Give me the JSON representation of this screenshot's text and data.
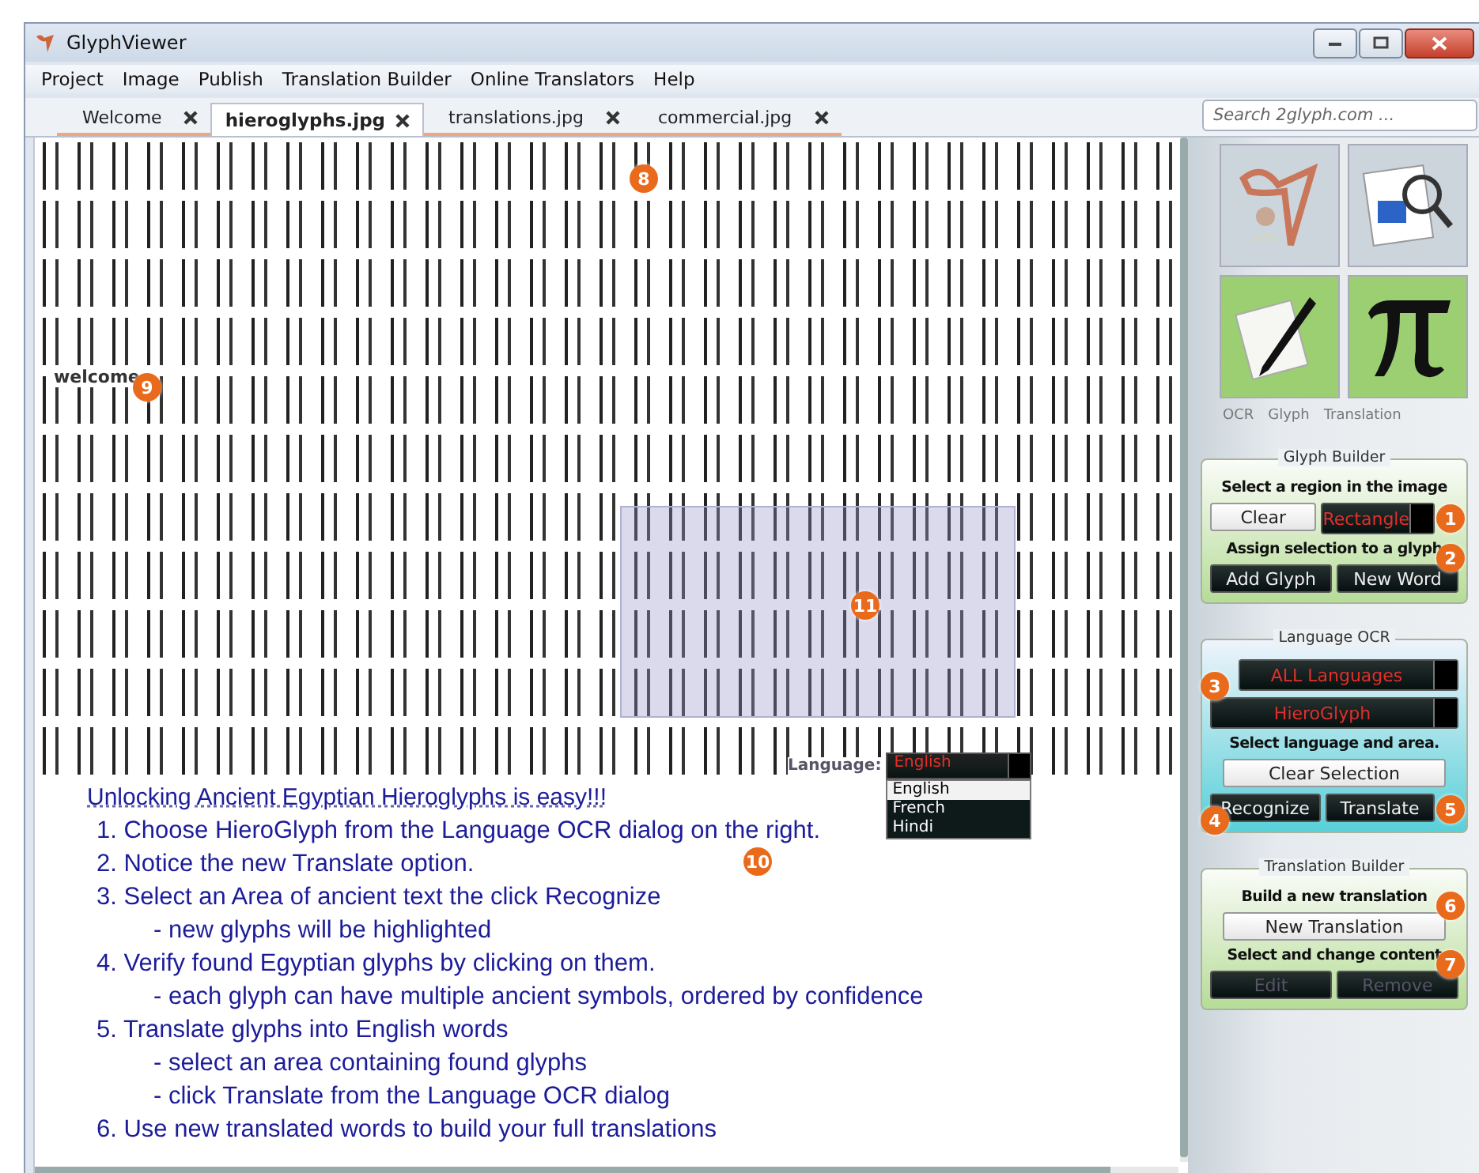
{
  "window": {
    "title": "GlyphViewer"
  },
  "menu": [
    "Project",
    "Image",
    "Publish",
    "Translation Builder",
    "Online Translators",
    "Help"
  ],
  "tabs": [
    {
      "label": "Welcome",
      "selected": false
    },
    {
      "label": "hieroglyphs.jpg",
      "selected": true
    },
    {
      "label": "translations.jpg",
      "selected": false
    },
    {
      "label": "commercial.jpg",
      "selected": false
    }
  ],
  "search": {
    "placeholder": "Search 2glyph.com ..."
  },
  "viewer": {
    "image_label": "welcome",
    "badges": [
      "8",
      "9",
      "11"
    ],
    "language_picker": {
      "label": "Language:",
      "value": "English",
      "options": [
        {
          "label": "English",
          "selected": true
        },
        {
          "label": "French",
          "selected": false
        },
        {
          "label": "Hindi",
          "selected": false
        }
      ]
    },
    "callout": "10",
    "instructions": {
      "title": "Unlocking Ancient Egyptian Hieroglyphs is easy!!!",
      "items": [
        {
          "text": "1. Choose HieroGlyph from the Language OCR dialog on the right."
        },
        {
          "text": "2. Notice the new Translate option."
        },
        {
          "text": "3. Select an Area of ancient text the click Recognize",
          "children": [
            "- new glyphs will be highlighted"
          ]
        },
        {
          "text": "4. Verify found Egyptian glyphs by clicking on them.",
          "children": [
            "- each glyph can have multiple ancient symbols, ordered by confidence"
          ]
        },
        {
          "text": "5. Translate glyphs into English words",
          "children": [
            "- select an area containing found glyphs",
            "- click Translate from the Language OCR dialog"
          ]
        },
        {
          "text": "6. Use new translated words to build your full translations"
        }
      ]
    }
  },
  "tools": {
    "tiles": [
      {
        "kind": "person",
        "active": false
      },
      {
        "kind": "magnifier",
        "active": false
      },
      {
        "kind": "pencil",
        "active": true
      },
      {
        "kind": "pi",
        "active": true
      }
    ],
    "captions": [
      "OCR",
      "Glyph",
      "Translation"
    ]
  },
  "groups": [
    {
      "title": "Glyph Builder",
      "kind": "green",
      "rows": [
        {
          "kind": "prompt",
          "text": "Select a region in the image"
        },
        {
          "kind": "buttons",
          "buttons": [
            {
              "kind": "light",
              "label": "Clear",
              "disabled": false
            },
            {
              "kind": "dropdown",
              "label": "Rectangle",
              "disabled": false,
              "badge": "1"
            }
          ]
        },
        {
          "kind": "prompt",
          "text": "Assign selection to a glyph",
          "badge": "2"
        },
        {
          "kind": "buttons",
          "buttons": [
            {
              "kind": "dark",
              "label": "Add Glyph",
              "disabled": false
            },
            {
              "kind": "dark",
              "label": "New Word",
              "disabled": false
            }
          ]
        }
      ]
    },
    {
      "title": "Language OCR",
      "kind": "blue",
      "rows": [
        {
          "kind": "buttons",
          "buttons": [
            {
              "kind": "dropdown",
              "label": "ALL Languages",
              "disabled": false,
              "badge": "3"
            }
          ]
        },
        {
          "kind": "buttons",
          "buttons": [
            {
              "kind": "dropdown",
              "label": "HieroGlyph",
              "disabled": false
            }
          ]
        },
        {
          "kind": "prompt",
          "text": "Select language and area."
        },
        {
          "kind": "buttons",
          "buttons": [
            {
              "kind": "light",
              "label": "Clear Selection",
              "disabled": false
            }
          ]
        },
        {
          "kind": "buttons",
          "buttons": [
            {
              "kind": "dark",
              "label": "Recognize",
              "disabled": false,
              "badge": "4"
            },
            {
              "kind": "dark",
              "label": "Translate",
              "disabled": false,
              "badge": "5"
            }
          ]
        }
      ]
    },
    {
      "title": "Translation Builder",
      "kind": "green",
      "rows": [
        {
          "kind": "prompt",
          "text": "Build a new translation",
          "badge": "6"
        },
        {
          "kind": "buttons",
          "buttons": [
            {
              "kind": "light",
              "label": "New Translation",
              "disabled": false
            }
          ]
        },
        {
          "kind": "prompt",
          "text": "Select and change content",
          "badge": "7"
        },
        {
          "kind": "buttons",
          "buttons": [
            {
              "kind": "dark",
              "label": "Edit",
              "disabled": true
            },
            {
              "kind": "dark",
              "label": "Remove",
              "disabled": true
            }
          ]
        }
      ]
    }
  ]
}
